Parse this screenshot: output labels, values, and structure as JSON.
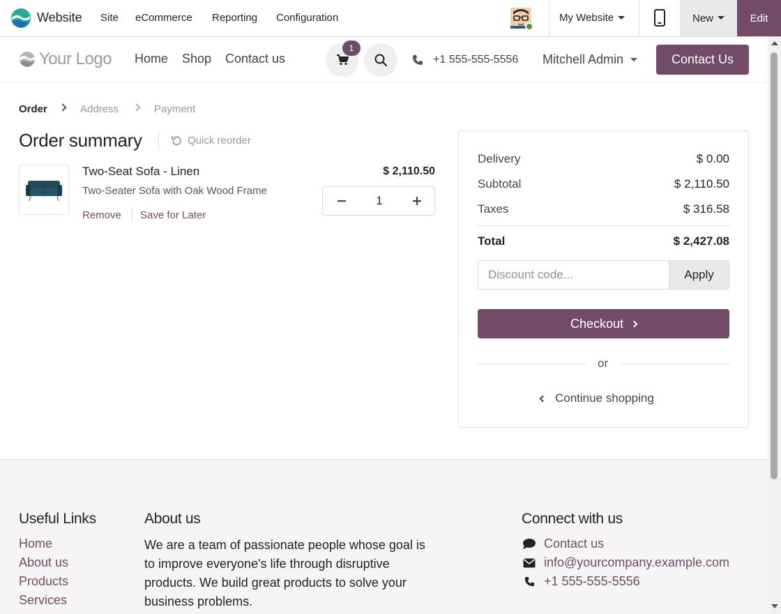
{
  "admin_bar": {
    "app_name": "Website",
    "menus": [
      "Site",
      "eCommerce",
      "Reporting",
      "Configuration"
    ],
    "website_selector": "My Website",
    "new_label": "New",
    "edit_label": "Edit"
  },
  "site_header": {
    "logo_text": "Your Logo",
    "nav": [
      "Home",
      "Shop",
      "Contact us"
    ],
    "cart_count": "1",
    "phone": "+1 555-555-5556",
    "user": "Mitchell Admin",
    "cta": "Contact Us"
  },
  "breadcrumb": {
    "steps": [
      "Order",
      "Address",
      "Payment"
    ]
  },
  "order": {
    "title": "Order summary",
    "quick_reorder": "Quick reorder",
    "item": {
      "name": "Two-Seat Sofa - Linen",
      "description": "Two-Seater Sofa with Oak Wood Frame",
      "price": "$ 2,110.50",
      "quantity": "1",
      "remove_label": "Remove",
      "save_label": "Save for Later"
    }
  },
  "summary": {
    "delivery_label": "Delivery",
    "delivery_value": "$ 0.00",
    "subtotal_label": "Subtotal",
    "subtotal_value": "$ 2,110.50",
    "taxes_label": "Taxes",
    "taxes_value": "$ 316.58",
    "total_label": "Total",
    "total_value": "$ 2,427.08",
    "discount_placeholder": "Discount code...",
    "apply_label": "Apply",
    "checkout_label": "Checkout",
    "or_label": "or",
    "continue_label": "Continue shopping"
  },
  "footer": {
    "links_heading": "Useful Links",
    "links": [
      "Home",
      "About us",
      "Products",
      "Services"
    ],
    "about_heading": "About us",
    "about_text": "We are a team of passionate people whose goal is to improve everyone's life through disruptive products. We build great products to solve your business problems.",
    "connect_heading": "Connect with us",
    "contact_label": "Contact us",
    "email": "info@yourcompany.example.com",
    "phone": "+1 555-555-5556"
  },
  "colors": {
    "brand": "#714b67",
    "admin_new_bg": "#e9e9ea",
    "footer_bg": "#f6f4f4"
  }
}
